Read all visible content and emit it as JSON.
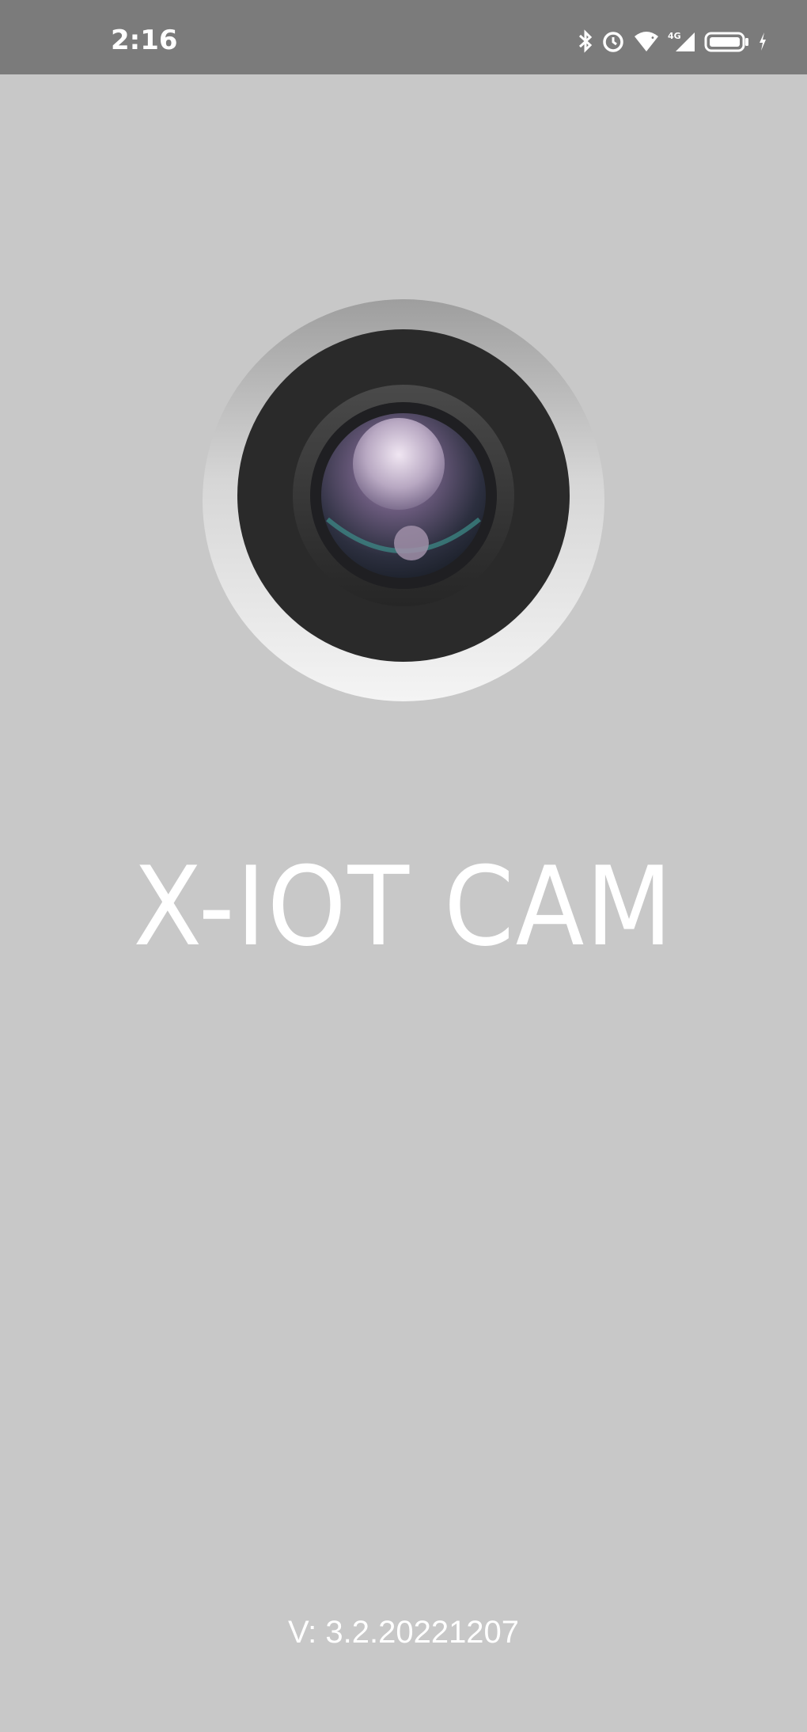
{
  "status_bar": {
    "time": "2:16",
    "icons": [
      "bluetooth-icon",
      "alarm-icon",
      "wifi-icon",
      "signal-icon",
      "battery-icon",
      "charging-icon"
    ],
    "battery_level": 1.0
  },
  "splash": {
    "logo": "camera-lens-icon",
    "title": "X-IOT CAM",
    "version": "V: 3.2.20221207"
  },
  "colors": {
    "background": "#c8c8c8",
    "status_bar": "#7b7b7b",
    "text": "#ffffff"
  }
}
